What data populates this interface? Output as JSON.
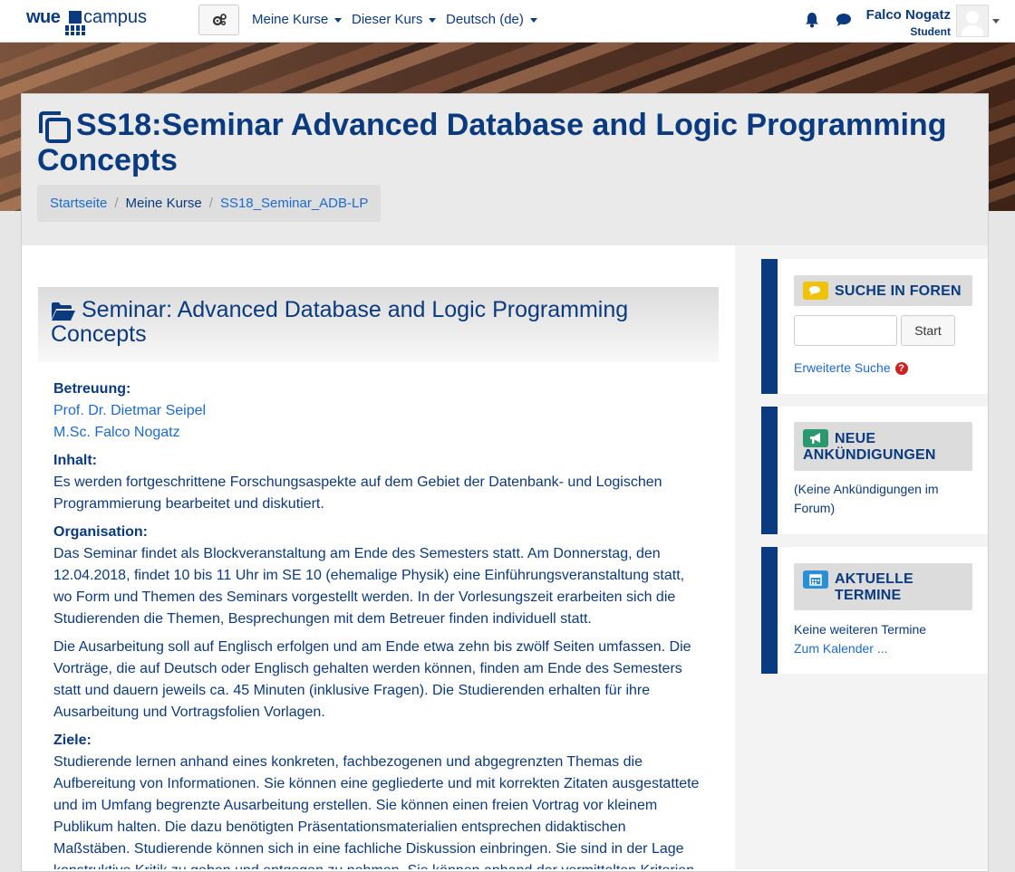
{
  "navbar": {
    "logo_part1": "wue",
    "logo_part2": "campus",
    "menu": [
      {
        "label": "Meine Kurse"
      },
      {
        "label": "Dieser Kurs"
      },
      {
        "label": "Deutsch (de)"
      }
    ],
    "user_name": "Falco Nogatz",
    "user_role": "Student"
  },
  "header": {
    "course_title": "SS18:Seminar Advanced Database and Logic Programming Concepts",
    "breadcrumb": [
      {
        "label": "Startseite"
      },
      {
        "label": "Meine Kurse"
      },
      {
        "label": "SS18_Seminar_ADB-LP"
      }
    ]
  },
  "main": {
    "section_title": "Seminar: Advanced Database and Logic Programming Concepts",
    "betreuung_label": "Betreuung:",
    "supervisors": [
      "Prof. Dr. Dietmar Seipel",
      "M.Sc. Falco Nogatz"
    ],
    "inhalt_label": "Inhalt:",
    "inhalt_text": "Es werden fortgeschrittene Forschungsaspekte auf dem Gebiet der Datenbank- und Logischen Programmierung bearbeitet und diskutiert.",
    "organisation_label": "Organisation:",
    "organisation_text1": "Das Seminar findet als Blockveranstaltung am Ende des Semesters statt. Am Donnerstag, den 12.04.2018, findet 10 bis 11 Uhr im SE 10 (ehemalige Physik) eine Einführungsveranstaltung statt, wo Form und Themen des Seminars vorgestellt werden. In der Vorlesungszeit erarbeiten sich die Studierenden die Themen, Besprechungen mit dem Betreuer finden individuell statt.",
    "organisation_text2": "Die Ausarbeitung soll auf Englisch erfolgen und am Ende etwa zehn bis zwölf Seiten umfassen. Die Vorträge, die auf Deutsch oder Englisch gehalten werden können, finden am Ende des Semesters statt und dauern jeweils ca. 45 Minuten (inklusive Fragen). Die Studierenden erhalten für ihre Ausarbeitung und Vortragsfolien Vorlagen.",
    "ziele_label": "Ziele:",
    "ziele_text": "Studierende lernen anhand eines konkreten, fachbezogenen und abgegrenzten Themas die Aufbereitung von Informationen. Sie können eine gegliederte und mit korrekten Zitaten ausgestattete und im Umfang begrenzte Ausarbeitung erstellen. Sie können einen freien Vortrag vor kleinem Publikum halten. Die dazu benötigten Präsentationsmaterialien entsprechen didaktischen Maßstäben. Studierende können sich in eine fachliche Diskussion einbringen. Sie sind in der Lage konstruktive Kritik zu geben und entgegen zu nehmen. Sie können anhand der vermittelten Kriterien"
  },
  "sidebar": {
    "forum_search": {
      "title": "SUCHE IN FOREN",
      "button": "Start",
      "advanced_link": "Erweiterte Suche",
      "icon_color": "#f0c20a"
    },
    "news": {
      "title_line1": "NEUE",
      "title_line2": "ANKÜNDIGUNGEN",
      "text": "(Keine Ankündigungen im Forum)",
      "icon_color": "#2a9a6e"
    },
    "events": {
      "title_line1": "AKTUELLE",
      "title_line2": "TERMINE",
      "text": "Keine weiteren Termine",
      "link": "Zum Kalender ...",
      "icon_color": "#2b8fd6"
    }
  }
}
